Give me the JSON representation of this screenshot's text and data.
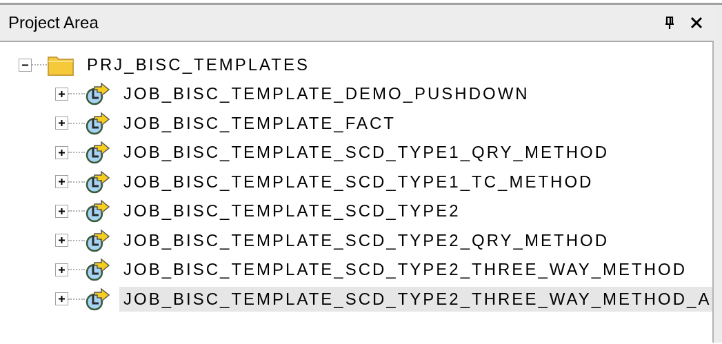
{
  "panel": {
    "title": "Project Area"
  },
  "tree": [
    {
      "label": "PRJ_BISC_TEMPLATES",
      "kind": "folder",
      "expanded": true,
      "selected": false,
      "children": [
        {
          "label": "JOB_BISC_TEMPLATE_DEMO_PUSHDOWN",
          "kind": "job",
          "expanded": false,
          "selected": false
        },
        {
          "label": "JOB_BISC_TEMPLATE_FACT",
          "kind": "job",
          "expanded": false,
          "selected": false
        },
        {
          "label": "JOB_BISC_TEMPLATE_SCD_TYPE1_QRY_METHOD",
          "kind": "job",
          "expanded": false,
          "selected": false
        },
        {
          "label": "JOB_BISC_TEMPLATE_SCD_TYPE1_TC_METHOD",
          "kind": "job",
          "expanded": false,
          "selected": false
        },
        {
          "label": "JOB_BISC_TEMPLATE_SCD_TYPE2",
          "kind": "job",
          "expanded": false,
          "selected": false
        },
        {
          "label": "JOB_BISC_TEMPLATE_SCD_TYPE2_QRY_METHOD",
          "kind": "job",
          "expanded": false,
          "selected": false
        },
        {
          "label": "JOB_BISC_TEMPLATE_SCD_TYPE2_THREE_WAY_METHOD",
          "kind": "job",
          "expanded": false,
          "selected": false
        },
        {
          "label": "JOB_BISC_TEMPLATE_SCD_TYPE2_THREE_WAY_METHOD_A",
          "kind": "job",
          "expanded": false,
          "selected": true
        }
      ]
    }
  ]
}
